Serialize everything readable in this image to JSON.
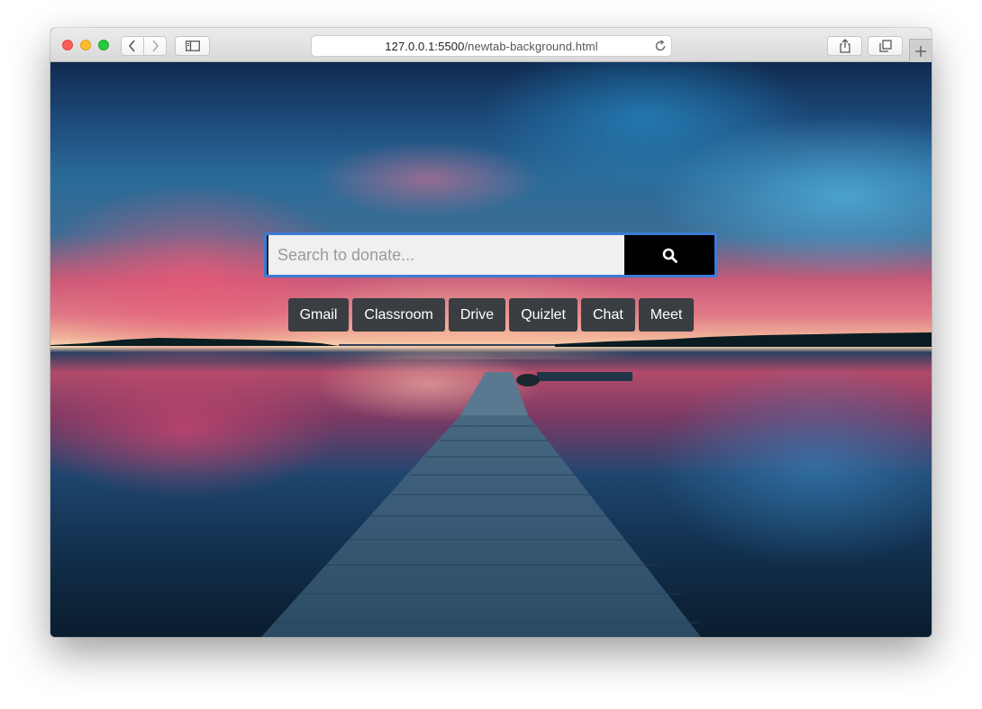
{
  "browser": {
    "url_host": "127.0.0.1:5500",
    "url_path": "/newtab-background.html",
    "icons": {
      "back": "chevron-left-icon",
      "forward": "chevron-right-icon",
      "sidebar": "sidebar-icon",
      "reload": "reload-icon",
      "share": "share-icon",
      "tabs": "tabs-overview-icon",
      "new_tab": "plus-icon"
    }
  },
  "search": {
    "placeholder": "Search to donate...",
    "value": "",
    "button_icon": "search-icon"
  },
  "quick_links": [
    {
      "label": "Gmail"
    },
    {
      "label": "Classroom"
    },
    {
      "label": "Drive"
    },
    {
      "label": "Quizlet"
    },
    {
      "label": "Chat"
    },
    {
      "label": "Meet"
    }
  ],
  "colors": {
    "search_focus_border": "#3d7bd6",
    "search_button": "#000000",
    "quick_link_bg": "#3a3d42",
    "quick_link_text": "#ffffff"
  }
}
